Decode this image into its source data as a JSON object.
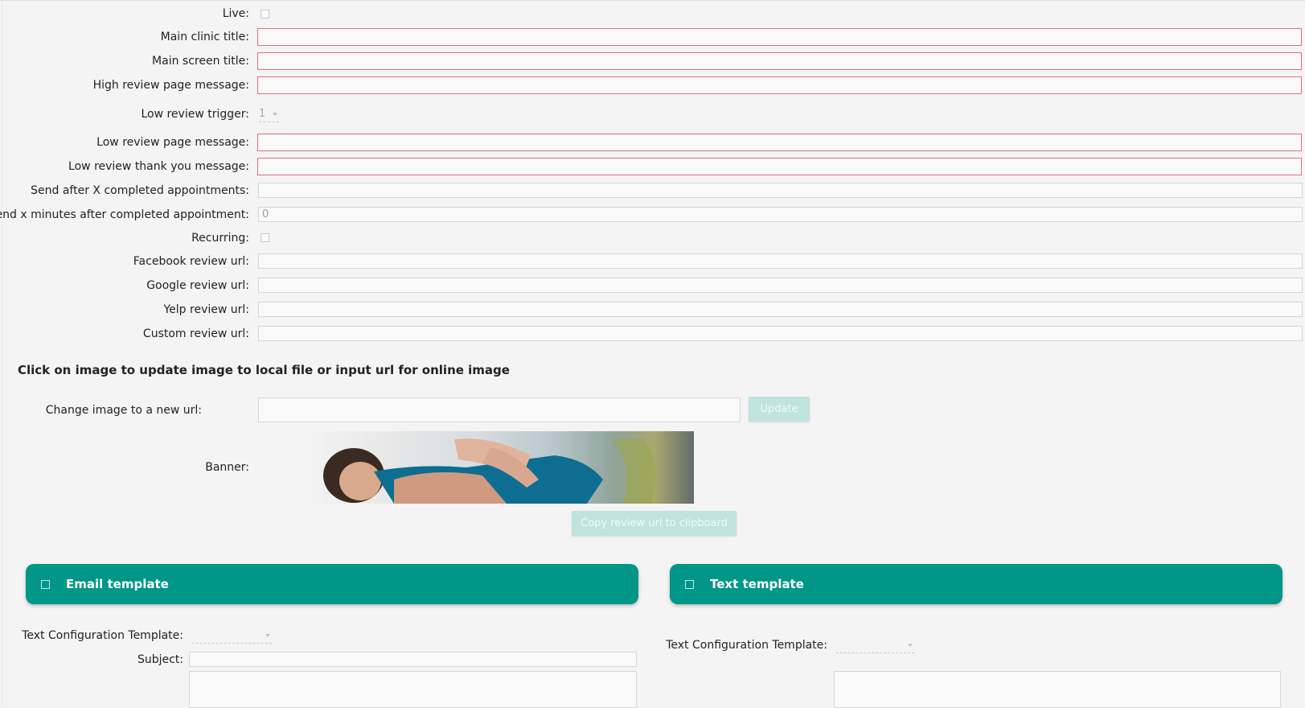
{
  "form": {
    "live_label": "Live:",
    "main_clinic_title_label": "Main clinic title:",
    "main_clinic_title_value": "",
    "main_screen_title_label": "Main screen title:",
    "main_screen_title_value": "",
    "high_review_message_label": "High review page message:",
    "high_review_message_value": "",
    "low_review_trigger_label": "Low review trigger:",
    "low_review_trigger_value": "1",
    "low_review_message_label": "Low review page message:",
    "low_review_message_value": "",
    "low_review_thanks_label": "Low review thank you message:",
    "low_review_thanks_value": "",
    "send_after_appts_label": "Send after X completed appointments:",
    "send_after_appts_value": "",
    "send_minutes_label": "Send x minutes after completed appointment:",
    "send_minutes_value": "0",
    "recurring_label": "Recurring:",
    "facebook_label": "Facebook review url:",
    "facebook_value": "",
    "google_label": "Google review url:",
    "google_value": "",
    "yelp_label": "Yelp review url:",
    "yelp_value": "",
    "custom_label": "Custom review url:",
    "custom_value": ""
  },
  "image_section": {
    "title": "Click on image to update image to local file or input url for online image",
    "change_url_label": "Change image to a new url:",
    "change_url_value": "",
    "update_button": "Update",
    "banner_label": "Banner:",
    "copy_button": "Copy review url to clipboard"
  },
  "email_template": {
    "header": "Email template",
    "config_label": "Text Configuration Template:",
    "config_value": "",
    "subject_label": "Subject:",
    "subject_value": ""
  },
  "text_template": {
    "header": "Text template",
    "config_label": "Text Configuration Template:",
    "config_value": ""
  },
  "colors": {
    "accent": "#009688",
    "required_border": "#e06e7c",
    "disabled_button": "#bfe3df"
  }
}
